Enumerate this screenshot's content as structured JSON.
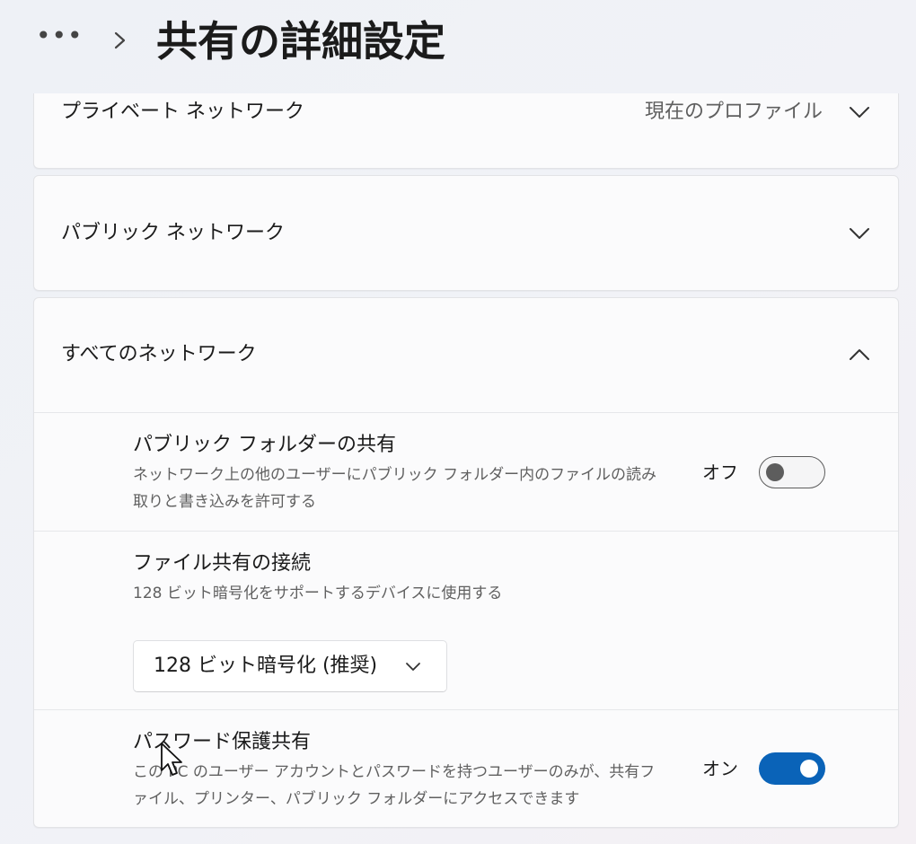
{
  "header": {
    "more_label": "•••",
    "title": "共有の詳細設定"
  },
  "private_network": {
    "label": "プライベート ネットワーク",
    "status": "現在のプロファイル"
  },
  "public_network": {
    "label": "パブリック ネットワーク"
  },
  "all_networks": {
    "label": "すべてのネットワーク",
    "public_folder_sharing": {
      "title": "パブリック フォルダーの共有",
      "description": "ネットワーク上の他のユーザーにパブリック フォルダー内のファイルの読み取りと書き込みを許可する",
      "state_label": "オフ",
      "enabled": false
    },
    "file_sharing_connections": {
      "title": "ファイル共有の接続",
      "description": "128 ビット暗号化をサポートするデバイスに使用する",
      "selected_option": "128 ビット暗号化 (推奨)"
    },
    "password_protected_sharing": {
      "title": "パスワード保護共有",
      "description": "この PC のユーザー アカウントとパスワードを持つユーザーのみが、共有ファイル、プリンター、パブリック フォルダーにアクセスできます",
      "state_label": "オン",
      "enabled": true
    }
  },
  "icons": {
    "breadcrumb": "chevron-right-icon",
    "collapsed": "chevron-down-icon",
    "expanded": "chevron-up-icon",
    "pointer": "mouse-cursor-icon"
  },
  "colors": {
    "accent": "#0a63b8",
    "toggle_off": "#5d5d5d",
    "card_background": "#fbfbfc",
    "page_background": "#eef1f6"
  }
}
